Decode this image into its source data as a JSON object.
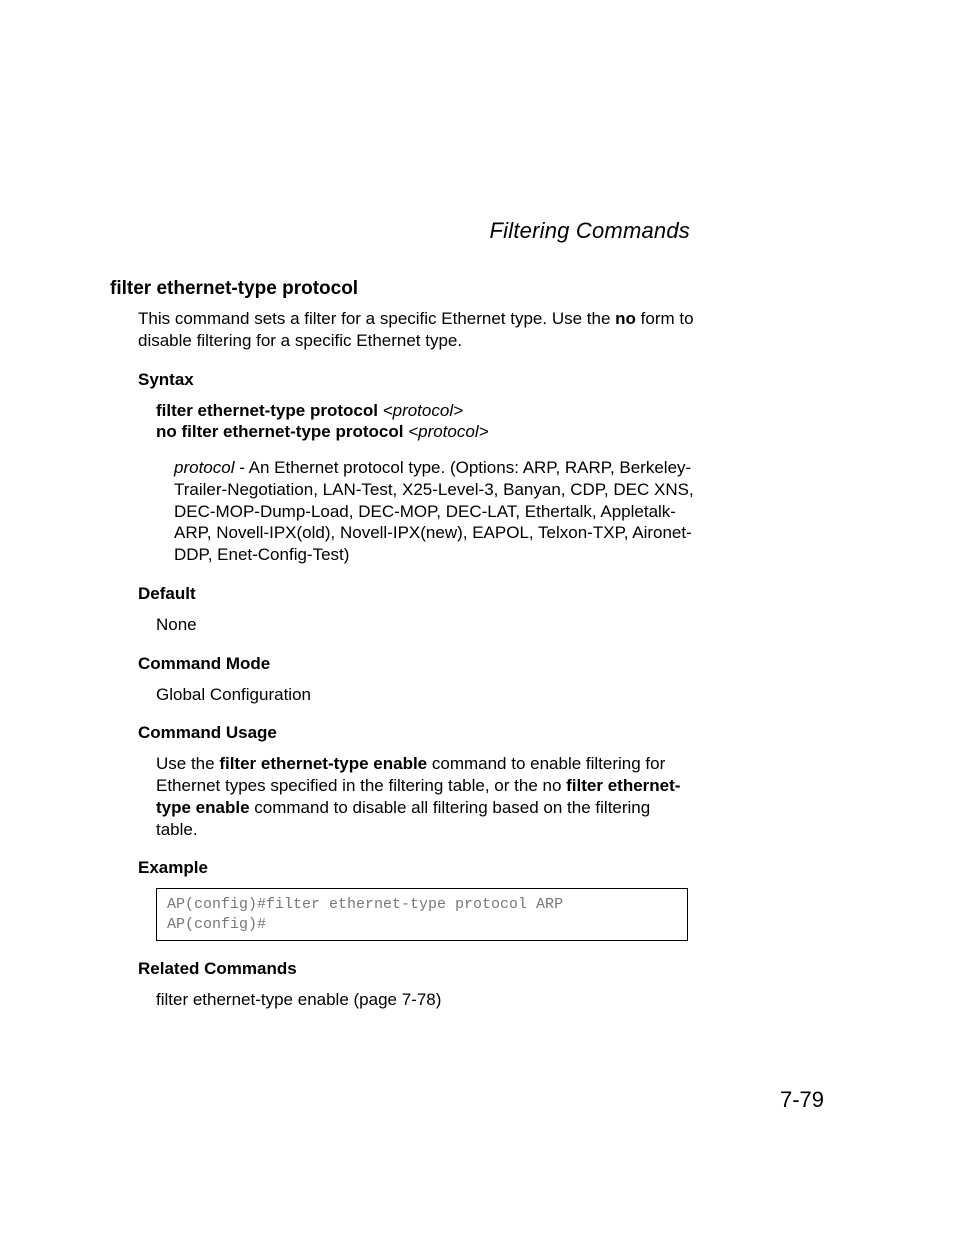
{
  "header": {
    "section_title": "Filtering Commands"
  },
  "title": "filter ethernet-type protocol",
  "intro": {
    "line1": "This command sets a filter for a specific Ethernet type. Use the ",
    "no_word": "no",
    "line2": " form to disable filtering for a specific Ethernet type."
  },
  "syntax": {
    "heading": "Syntax",
    "line1_bold": "filter ethernet-type protocol ",
    "line1_italic": "<protocol>",
    "line2_bold": "no filter ethernet-type protocol ",
    "line2_italic": "<protocol>",
    "desc_term": "protocol",
    "desc_text": " - An Ethernet protocol type. (Options: ARP, RARP, Berkeley-Trailer-Negotiation, LAN-Test, X25-Level-3, Banyan, CDP, DEC XNS, DEC-MOP-Dump-Load, DEC-MOP, DEC-LAT, Ethertalk, Appletalk-ARP, Novell-IPX(old), Novell-IPX(new), EAPOL, Telxon-TXP, Aironet-DDP, Enet-Config-Test)"
  },
  "default": {
    "heading": "Default",
    "value": "None"
  },
  "command_mode": {
    "heading": "Command Mode",
    "value": "Global Configuration"
  },
  "command_usage": {
    "heading": "Command Usage",
    "pre1": "Use the ",
    "bold1": "filter ethernet-type enable",
    "mid1": " command to enable filtering for Ethernet types specified in the filtering table, or the no ",
    "bold2": "filter ethernet-type enable",
    "post1": " command to disable all filtering based on the filtering table."
  },
  "example": {
    "heading": "Example",
    "code": "AP(config)#filter ethernet-type protocol ARP\nAP(config)#"
  },
  "related": {
    "heading": "Related Commands",
    "text": "filter ethernet-type enable (page 7-78)"
  },
  "page_number": "7-79"
}
